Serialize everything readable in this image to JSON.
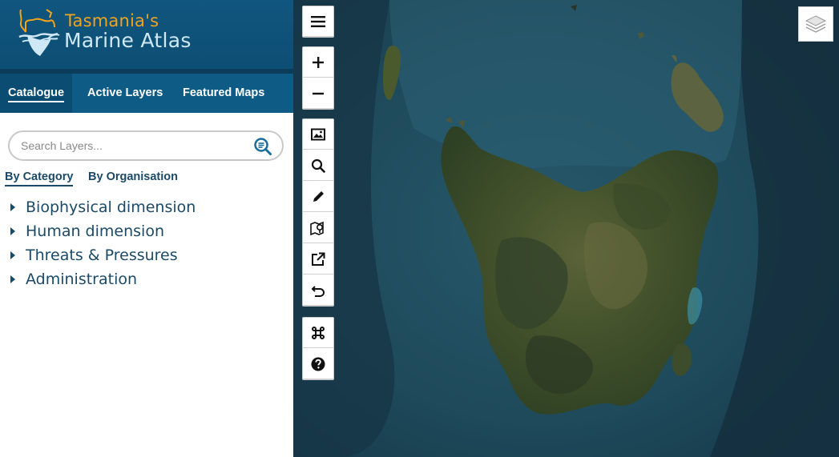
{
  "header": {
    "title_line1": "Tasmania's",
    "title_line2": "Marine Atlas",
    "logo_icon": "tasmania-map-logo",
    "colors": {
      "header_bg": "#11567e",
      "title_accent": "#f2a31c",
      "title_light": "#cfe8f5"
    }
  },
  "tabs": [
    {
      "label": "Catalogue",
      "active": true
    },
    {
      "label": "Active Layers",
      "active": false
    },
    {
      "label": "Featured Maps",
      "active": false
    }
  ],
  "search": {
    "placeholder": "Search Layers...",
    "value": "",
    "icon": "search-icon"
  },
  "subtabs": [
    {
      "label": "By Category",
      "active": true
    },
    {
      "label": "By Organisation",
      "active": false
    }
  ],
  "categories": [
    {
      "label": "Biophysical dimension"
    },
    {
      "label": "Human dimension"
    },
    {
      "label": "Threats & Pressures"
    },
    {
      "label": "Administration"
    }
  ],
  "map_toolbar": [
    {
      "name": "menu-button",
      "icon": "hamburger-icon"
    },
    {
      "name": "zoom-in-button",
      "icon": "plus-icon"
    },
    {
      "name": "zoom-out-button",
      "icon": "minus-icon"
    },
    {
      "name": "image-export-button",
      "icon": "image-icon"
    },
    {
      "name": "search-map-button",
      "icon": "magnifier-icon"
    },
    {
      "name": "draw-button",
      "icon": "pencil-icon"
    },
    {
      "name": "map-tour-button",
      "icon": "map-pin-icon"
    },
    {
      "name": "open-external-button",
      "icon": "external-link-icon"
    },
    {
      "name": "reset-button",
      "icon": "undo-icon"
    },
    {
      "name": "shortcuts-button",
      "icon": "command-icon"
    },
    {
      "name": "help-button",
      "icon": "question-icon"
    }
  ],
  "basemap": {
    "icon": "layers-icon"
  },
  "colors": {
    "ocean": "#1d4a5c",
    "land": "#3f4f2c",
    "text_dark": "#1b4a68"
  }
}
